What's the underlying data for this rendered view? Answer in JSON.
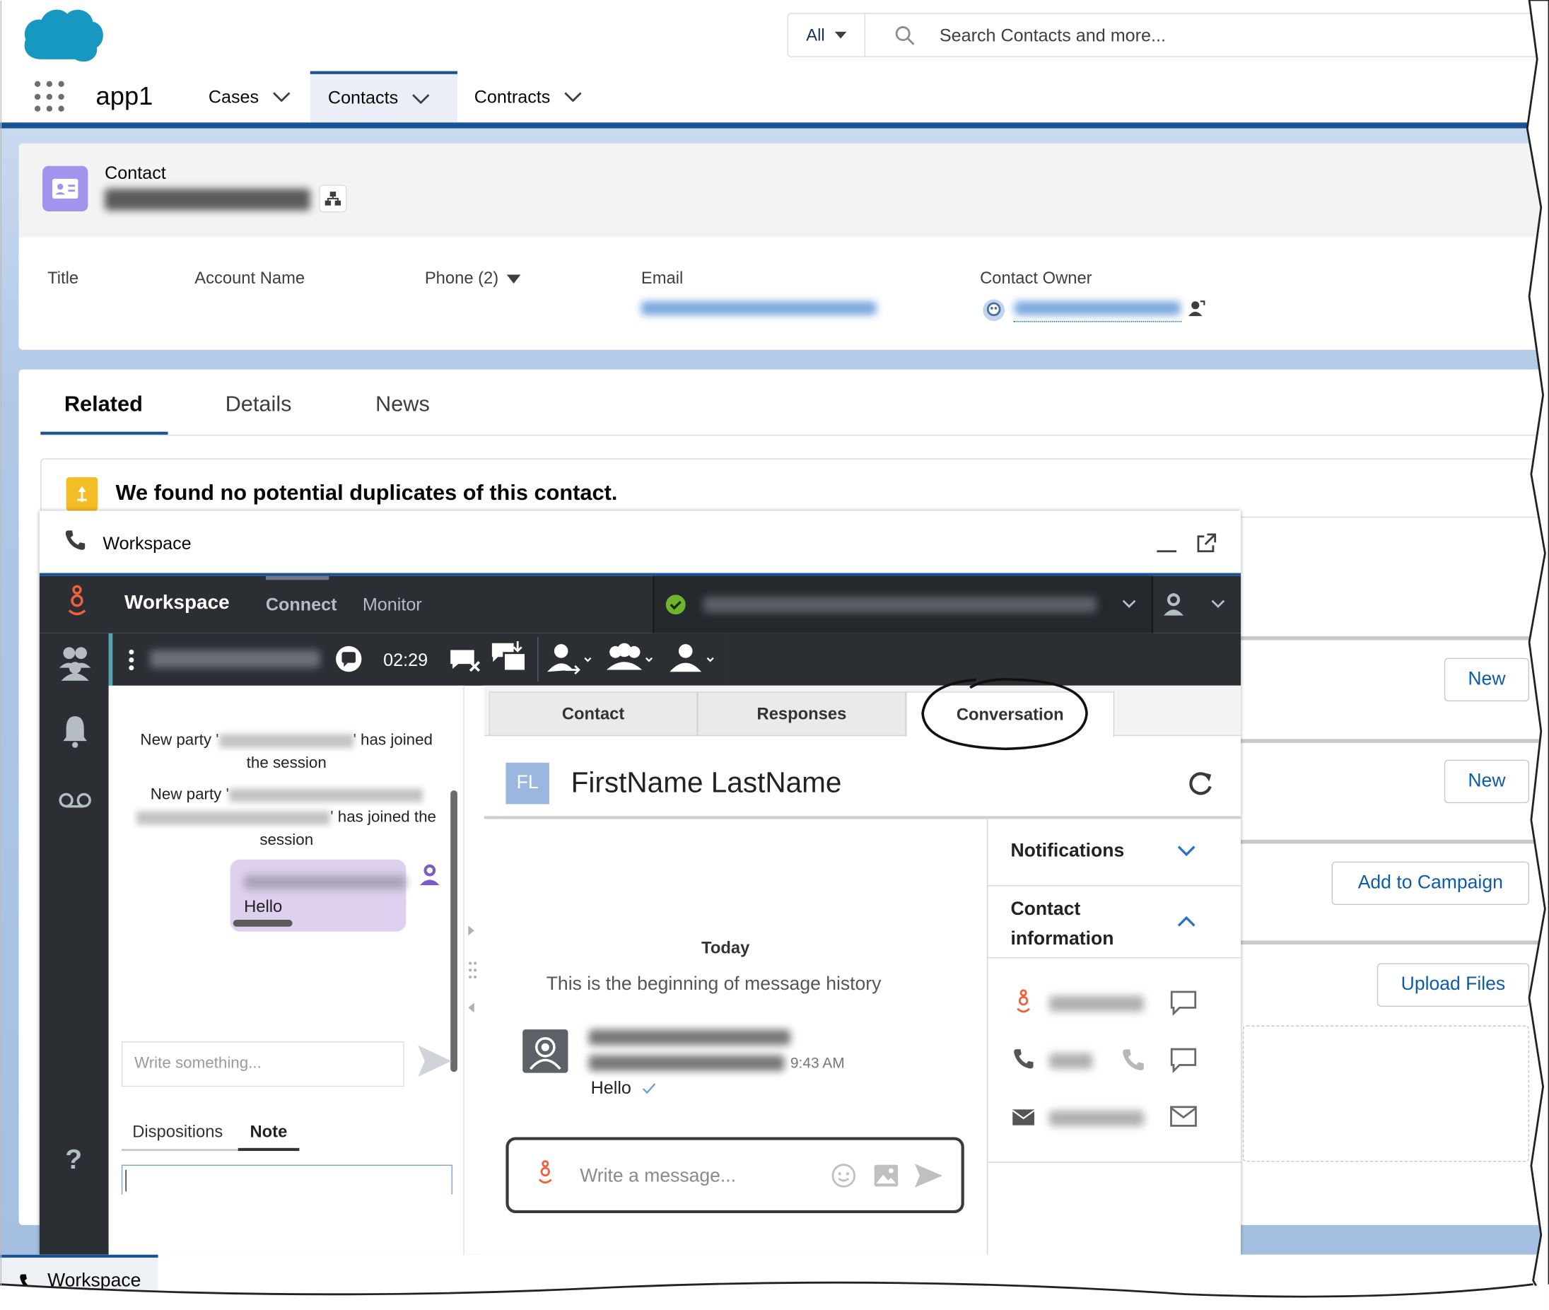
{
  "app": {
    "name": "app1"
  },
  "search": {
    "scope": "All",
    "placeholder": "Search Contacts and more..."
  },
  "nav": {
    "tabs": [
      {
        "label": "Cases"
      },
      {
        "label": "Contacts"
      },
      {
        "label": "Contracts"
      }
    ]
  },
  "record": {
    "object_label": "Contact",
    "fields": {
      "title": "Title",
      "account_name": "Account Name",
      "phone": "Phone (2)",
      "email": "Email",
      "owner": "Contact Owner"
    }
  },
  "related_tabs": [
    "Related",
    "Details",
    "News"
  ],
  "duplicates": {
    "message": "We found no potential duplicates of this contact."
  },
  "side_buttons": {
    "new1": "New",
    "new2": "New",
    "campaign": "Add to Campaign",
    "upload": "Upload Files"
  },
  "workspace": {
    "window_title": "Workspace",
    "brand": "Workspace",
    "nav": {
      "connect": "Connect",
      "monitor": "Monitor"
    },
    "timer": "02:29",
    "transcript": {
      "msg1_pre": "New party '",
      "msg1_post": "' has joined",
      "msg1_end": "the session",
      "msg2_pre": "New party '",
      "msg2_post": "' has joined the",
      "msg2_end": "session",
      "bubble_text": "Hello",
      "input_placeholder": "Write something..."
    },
    "bottom_tabs": {
      "dispositions": "Dispositions",
      "note": "Note"
    },
    "conv_tabs": {
      "contact": "Contact",
      "responses": "Responses",
      "conversation": "Conversation"
    },
    "contact_initials": "FL",
    "contact_name": "FirstName LastName",
    "history": {
      "day": "Today",
      "beginning": "This is the beginning of message history",
      "time": "9:43 AM",
      "message": "Hello"
    },
    "composer_placeholder": "Write a message...",
    "panel": {
      "notifications": "Notifications",
      "contact_information": "Contact information"
    },
    "help": "?"
  },
  "utility": {
    "workspace": "Workspace"
  },
  "colors": {
    "brand_blue": "#1b5297",
    "dark_toolbar": "#2b2e33",
    "genesys_orange": "#f0613b",
    "link_blue": "#0b5cab"
  }
}
